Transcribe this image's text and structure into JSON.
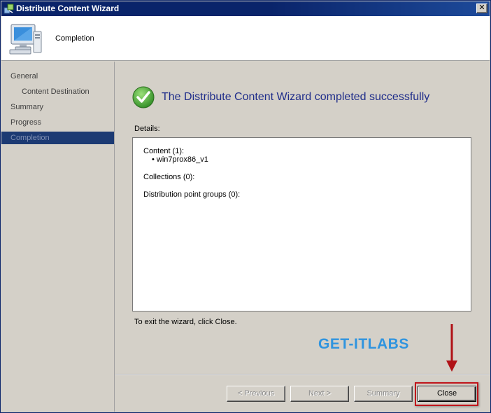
{
  "window": {
    "title": "Distribute Content Wizard",
    "close_glyph": "✕",
    "icon": "wizard-app-icon"
  },
  "header": {
    "title": "Completion",
    "icon": "computer-icon"
  },
  "nav": {
    "items": [
      {
        "label": "General",
        "active": false,
        "sub": false
      },
      {
        "label": "Content Destination",
        "active": false,
        "sub": true
      },
      {
        "label": "Summary",
        "active": false,
        "sub": false
      },
      {
        "label": "Progress",
        "active": false,
        "sub": false
      },
      {
        "label": "Completion",
        "active": true,
        "sub": false
      }
    ]
  },
  "main": {
    "success_message": "The Distribute Content Wizard completed successfully",
    "success_icon": "green-check-icon",
    "details_label": "Details:",
    "details": {
      "content_header": "Content (1):",
      "content_item": "• win7prox86_v1",
      "collections": "Collections (0):",
      "dp_groups": "Distribution point groups (0):"
    },
    "exit_hint": "To exit the wizard, click Close.",
    "watermark": "GET-ITLABS"
  },
  "buttons": {
    "previous": "< Previous",
    "next": "Next >",
    "summary": "Summary",
    "close": "Close"
  },
  "colors": {
    "titlebar": "#0a246a",
    "nav_active": "#1c3a73",
    "success_text": "#1f2d8a",
    "watermark": "#2f94df",
    "highlight": "#c0151b"
  }
}
